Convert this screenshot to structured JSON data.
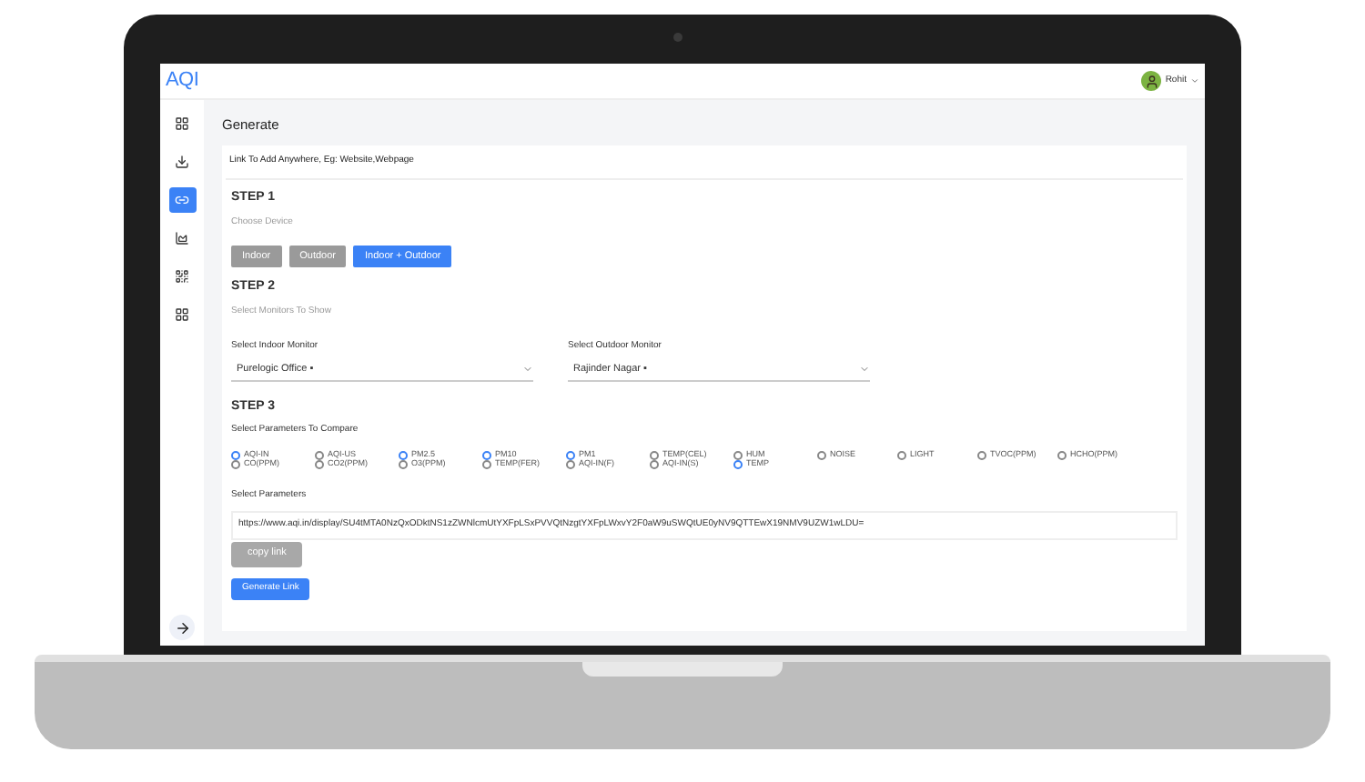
{
  "header": {
    "logo": "AQI",
    "user": "Rohit"
  },
  "sidebar": {
    "items": [
      {
        "selected": false
      },
      {
        "selected": false
      },
      {
        "selected": true
      },
      {
        "selected": false
      },
      {
        "selected": false
      },
      {
        "selected": false
      }
    ]
  },
  "page_title": "Generate",
  "card_title": "Link To Add Anywhere, Eg: Website,Webpage",
  "step1": {
    "title": "STEP 1",
    "subtitle": "Choose Device",
    "devices": [
      {
        "label": "Indoor",
        "selected": false
      },
      {
        "label": "Outdoor",
        "selected": false
      },
      {
        "label": "Indoor + Outdoor",
        "selected": true
      }
    ]
  },
  "step2": {
    "title": "STEP 2",
    "subtitle": "Select Monitors To Show",
    "selects": [
      {
        "label": "Select Indoor Monitor",
        "value": "Purelogic Office ▪"
      },
      {
        "label": "Select Outdoor Monitor",
        "value": "Rajinder Nagar ▪"
      }
    ]
  },
  "step3": {
    "title": "STEP 3",
    "subtitle": "Select Parameters To Compare",
    "parameter_columns": [
      [
        {
          "label": "AQI-IN",
          "checked": true
        },
        {
          "label": "CO(PPM)",
          "checked": false
        }
      ],
      [
        {
          "label": "AQI-US",
          "checked": false
        },
        {
          "label": "CO2(PPM)",
          "checked": false
        }
      ],
      [
        {
          "label": "PM2.5",
          "checked": true
        },
        {
          "label": "O3(PPM)",
          "checked": false
        }
      ],
      [
        {
          "label": "PM10",
          "checked": true
        },
        {
          "label": "TEMP(FER)",
          "checked": false
        }
      ],
      [
        {
          "label": "PM1",
          "checked": true
        },
        {
          "label": "AQI-IN(F)",
          "checked": false
        }
      ],
      [
        {
          "label": "TEMP(CEL)",
          "checked": false
        },
        {
          "label": "AQI-IN(S)",
          "checked": false
        }
      ],
      [
        {
          "label": "HUM",
          "checked": false
        },
        {
          "label": "TEMP",
          "checked": true
        }
      ],
      [
        {
          "label": "NOISE",
          "checked": false
        }
      ],
      [
        {
          "label": "LIGHT",
          "checked": false
        }
      ],
      [
        {
          "label": "TVOC(PPM)",
          "checked": false
        }
      ],
      [
        {
          "label": "HCHO(PPM)",
          "checked": false
        }
      ]
    ]
  },
  "select_parameters_label": "Select Parameters",
  "link": "https://www.aqi.in/display/SU4tMTA0NzQxODktNS1zZWNlcmUtYXFpLSxPVVQtNzgtYXFpLWxvY2F0aW9uSWQtUE0yNV9QTTEwX19NMV9UZW1wLDU=",
  "copy_button": "copy link",
  "generate_button": "Generate Link"
}
